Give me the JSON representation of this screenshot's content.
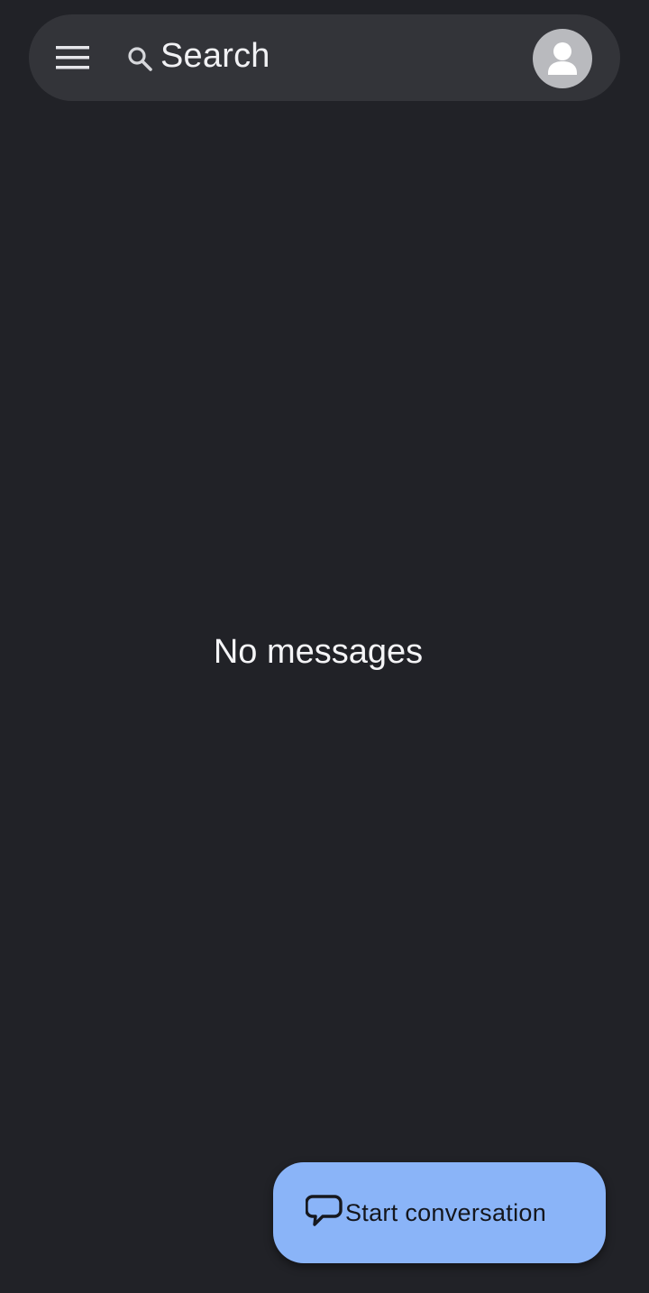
{
  "top_bar": {
    "menu_icon": "menu-icon",
    "search_icon": "search-icon",
    "search_label": "Search",
    "avatar_icon": "account-avatar-icon"
  },
  "main": {
    "empty_state_text": "No messages"
  },
  "fab": {
    "icon": "chat-bubble-icon",
    "label": "Start conversation"
  },
  "colors": {
    "background": "#212227",
    "search_bar": "#333439",
    "fab": "#8ab4f8",
    "avatar": "#b9babe",
    "text_primary": "#f4f4f6"
  }
}
